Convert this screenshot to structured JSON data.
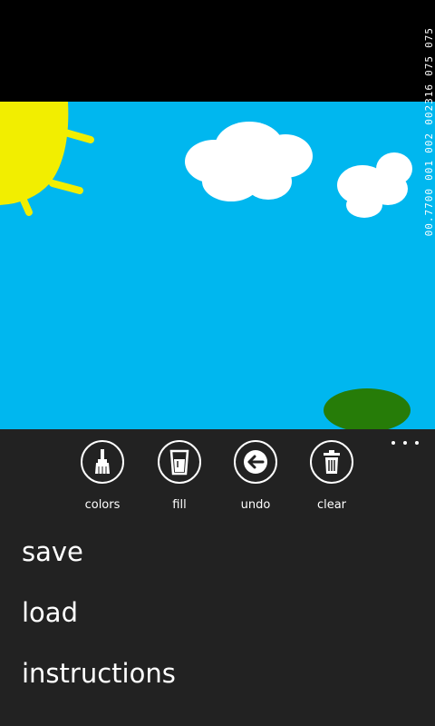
{
  "debug_counter": [
    "075",
    "075",
    "002316",
    "002",
    "001",
    "00.7700"
  ],
  "appbar": {
    "buttons": [
      {
        "label": "colors",
        "icon": "paintbrush-icon"
      },
      {
        "label": "fill",
        "icon": "fill-cup-icon"
      },
      {
        "label": "undo",
        "icon": "back-arrow-icon"
      },
      {
        "label": "clear",
        "icon": "trash-icon"
      }
    ],
    "more_icon": "ellipsis-icon",
    "menu": [
      "save",
      "load",
      "instructions"
    ]
  },
  "colors": {
    "sky": "#00b7ef",
    "sun": "#f2ee00",
    "cloud": "#ffffff",
    "tree": "#267c08",
    "trunk": "#8a5a2b",
    "appbar": "#222222"
  }
}
